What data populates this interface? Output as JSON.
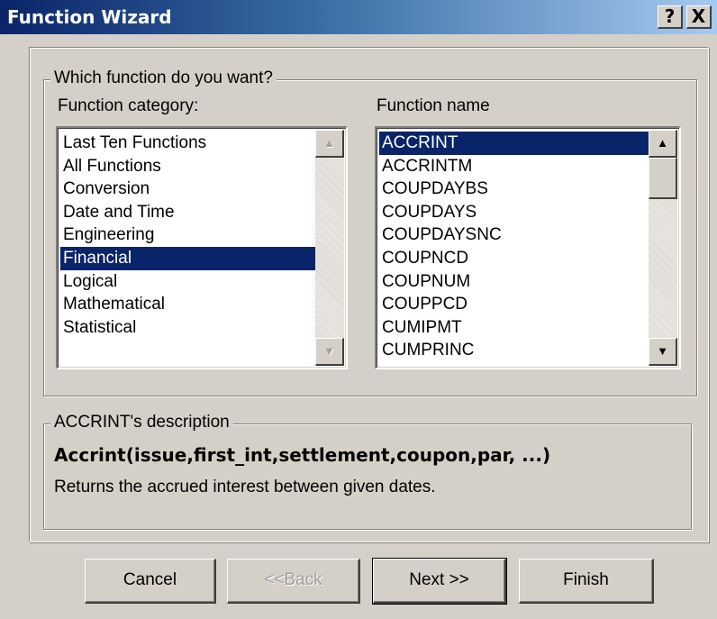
{
  "window": {
    "title": "Function Wizard",
    "help_button": "?",
    "close_button": "X"
  },
  "function_group": {
    "legend": "Which function do you want?",
    "category_label": "Function category:",
    "name_label": "Function name",
    "categories": [
      {
        "label": "Last Ten Functions",
        "selected": false
      },
      {
        "label": "All Functions",
        "selected": false
      },
      {
        "label": "Conversion",
        "selected": false
      },
      {
        "label": "Date and Time",
        "selected": false
      },
      {
        "label": "Engineering",
        "selected": false
      },
      {
        "label": "Financial",
        "selected": true
      },
      {
        "label": "Logical",
        "selected": false
      },
      {
        "label": "Mathematical",
        "selected": false
      },
      {
        "label": "Statistical",
        "selected": false
      }
    ],
    "functions": [
      {
        "label": "ACCRINT",
        "selected": true
      },
      {
        "label": "ACCRINTM",
        "selected": false
      },
      {
        "label": "COUPDAYBS",
        "selected": false
      },
      {
        "label": "COUPDAYS",
        "selected": false
      },
      {
        "label": "COUPDAYSNC",
        "selected": false
      },
      {
        "label": "COUPNCD",
        "selected": false
      },
      {
        "label": "COUPNUM",
        "selected": false
      },
      {
        "label": "COUPPCD",
        "selected": false
      },
      {
        "label": "CUMIPMT",
        "selected": false
      },
      {
        "label": "CUMPRINC",
        "selected": false
      }
    ]
  },
  "description": {
    "legend": "ACCRINT's description",
    "signature": "Accrint(issue,first_int,settlement,coupon,par, ...)",
    "text": "Returns the accrued interest between given dates."
  },
  "buttons": {
    "cancel": "Cancel",
    "back": "<<Back",
    "next": "Next >>",
    "finish": "Finish"
  },
  "colors": {
    "selection": "#0a246a",
    "dialog_face": "#d4d0c8"
  }
}
